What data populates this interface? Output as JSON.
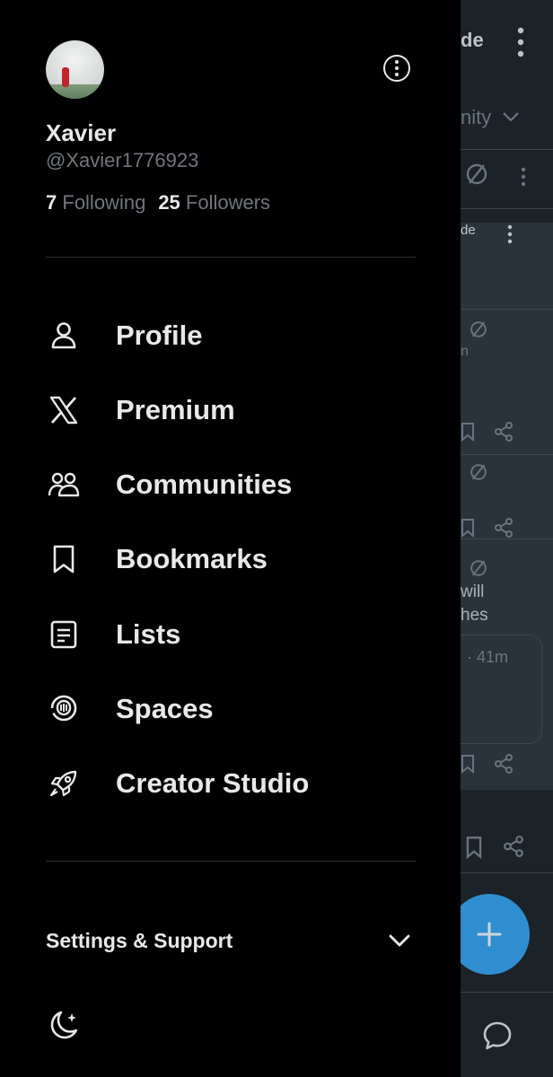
{
  "profile": {
    "name": "Xavier",
    "handle": "@Xavier1776923",
    "following_count": "7",
    "following_label": "Following",
    "followers_count": "25",
    "followers_label": "Followers"
  },
  "menu": [
    {
      "label": "Profile",
      "icon": "person-icon"
    },
    {
      "label": "Premium",
      "icon": "x-logo-icon"
    },
    {
      "label": "Communities",
      "icon": "communities-icon"
    },
    {
      "label": "Bookmarks",
      "icon": "bookmark-icon"
    },
    {
      "label": "Lists",
      "icon": "list-icon"
    },
    {
      "label": "Spaces",
      "icon": "spaces-icon"
    },
    {
      "label": "Creator Studio",
      "icon": "rocket-icon"
    }
  ],
  "settings": {
    "label": "Settings & Support"
  },
  "background": {
    "header_fragment": "de",
    "community_fragment": "nity",
    "card_fragment": "de",
    "post_fragment_1": "n",
    "post_fragment_2": "will",
    "post_fragment_3": "hes",
    "timestamp_fragment": "· 41m"
  },
  "colors": {
    "accent": "#1d9bf0",
    "background": "#000000",
    "secondary_text": "#71767b"
  }
}
